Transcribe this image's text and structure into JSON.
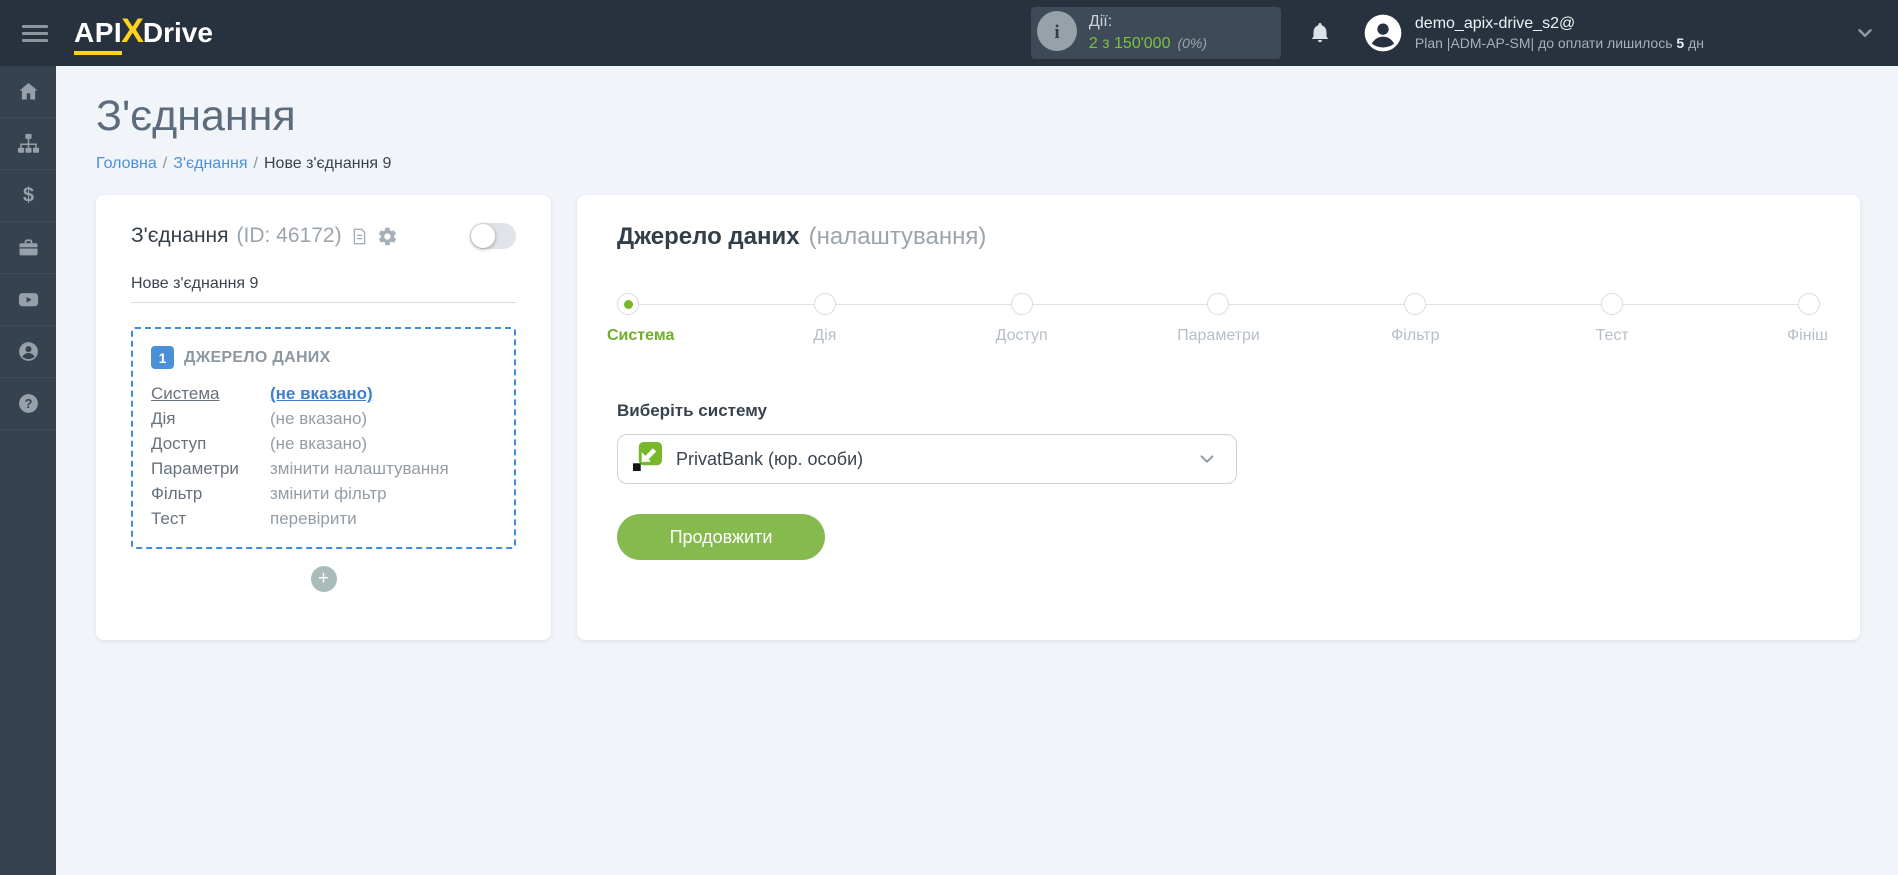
{
  "topbar": {
    "logo": {
      "part_api": "API",
      "part_x": "X",
      "part_drive": "Drive"
    },
    "stats": {
      "label": "Дії:",
      "value": "2 з 150'000",
      "percent": "(0%)"
    },
    "user": {
      "email": "demo_apix-drive_s2@",
      "plan_text": "Plan |ADM-AP-SM| до оплати лишилось",
      "days": "5",
      "days_unit": "дн"
    }
  },
  "sidebar": {
    "items": [
      {
        "id": "home",
        "icon": "home-icon"
      },
      {
        "id": "connections",
        "icon": "sitemap-icon"
      },
      {
        "id": "billing",
        "icon": "dollar-icon"
      },
      {
        "id": "services",
        "icon": "briefcase-icon"
      },
      {
        "id": "video",
        "icon": "youtube-icon"
      },
      {
        "id": "account",
        "icon": "user-icon"
      },
      {
        "id": "help",
        "icon": "question-icon"
      }
    ]
  },
  "page": {
    "title": "З'єднання",
    "breadcrumb": [
      {
        "label": "Головна",
        "link": true
      },
      {
        "label": "З'єднання",
        "link": true
      },
      {
        "label": "Нове з'єднання 9",
        "link": false
      }
    ]
  },
  "connection_card": {
    "title": "З'єднання",
    "id_text": "(ID: 46172)",
    "name_value": "Нове з'єднання 9",
    "source_block": {
      "badge": "1",
      "heading": "ДЖЕРЕЛО ДАНИХ",
      "rows": [
        {
          "label": "Система",
          "value": "(не вказано)",
          "highlight": true
        },
        {
          "label": "Дія",
          "value": "(не вказано)",
          "highlight": false
        },
        {
          "label": "Доступ",
          "value": "(не вказано)",
          "highlight": false
        },
        {
          "label": "Параметри",
          "value": "змінити налаштування",
          "highlight": false
        },
        {
          "label": "Фільтр",
          "value": "змінити фільтр",
          "highlight": false
        },
        {
          "label": "Тест",
          "value": "перевірити",
          "highlight": false
        }
      ]
    },
    "add_button": "+"
  },
  "setup_card": {
    "title": "Джерело даних",
    "subtitle": "(налаштування)",
    "steps": [
      {
        "id": "system",
        "label": "Система",
        "active": true
      },
      {
        "id": "action",
        "label": "Дія",
        "active": false
      },
      {
        "id": "access",
        "label": "Доступ",
        "active": false
      },
      {
        "id": "params",
        "label": "Параметри",
        "active": false
      },
      {
        "id": "filter",
        "label": "Фільтр",
        "active": false
      },
      {
        "id": "test",
        "label": "Тест",
        "active": false
      },
      {
        "id": "finish",
        "label": "Фініш",
        "active": false
      }
    ],
    "system_select": {
      "label": "Виберіть систему",
      "value": "PrivatBank (юр. особи)",
      "icon": "privatbank-logo"
    },
    "continue_label": "Продовжити"
  },
  "colors": {
    "topbar_bg": "#28323e",
    "sidebar_bg": "#36424f",
    "accent_green": "#7cc142",
    "step_active_green": "#76b82a",
    "button_green": "#86ba4e",
    "accent_blue": "#4a90d9",
    "dashed_border_blue": "#3f8be0",
    "page_bg": "#f1f4f8"
  }
}
